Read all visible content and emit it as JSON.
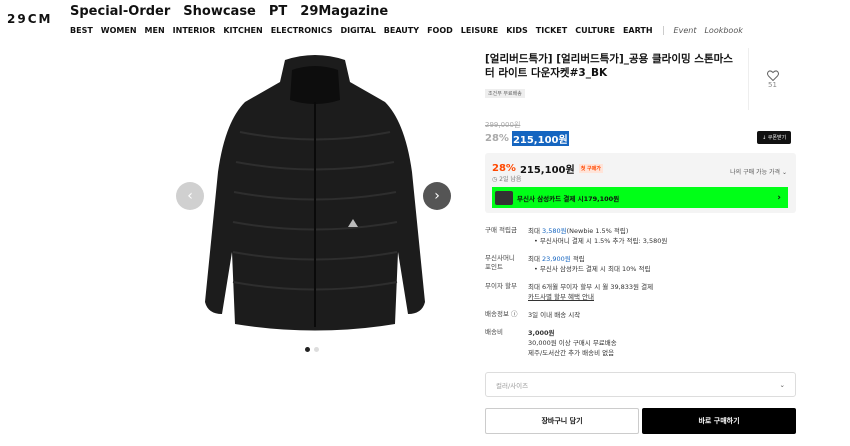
{
  "logo": "29CM",
  "topnav": [
    "Special-Order",
    "Showcase",
    "PT",
    "29Magazine"
  ],
  "catnav": [
    "BEST",
    "WOMEN",
    "MEN",
    "INTERIOR",
    "KITCHEN",
    "ELECTRONICS",
    "DIGITAL",
    "BEAUTY",
    "FOOD",
    "LEISURE",
    "KIDS",
    "TICKET",
    "CULTURE",
    "EARTH"
  ],
  "catnav_extra": [
    "Event",
    "Lookbook"
  ],
  "product": {
    "title": "[얼리버드특가] [얼리버드특가]_공용 클라이밍 스톤마스터 라이트 다운자켓#3_BK",
    "tag": "조건부 무료배송",
    "likes": "51",
    "original_price": "299,000원",
    "discount_rate": "28%",
    "price": "215,100원",
    "coupon_label": "↓ 쿠폰받기"
  },
  "benefit": {
    "rate": "28%",
    "price": "215,100원",
    "badge": "첫 구매가",
    "time_left": "◷ 2일 남음",
    "my_price": "나의 구매 가능 가격",
    "promo_text": "무신사 삼성카드 결제 시 ",
    "promo_price": "179,100원"
  },
  "details": {
    "points_label": "구매 적립금",
    "points_pre": "최대 ",
    "points_amount": "3,580원",
    "points_post": "(Newbie 1.5% 적립)",
    "points_sub": "무신사머니 결제 시 1.5% 추가 적립: 3,580원",
    "money_label1": "무신사머니",
    "money_label2": "포인트",
    "money_pre": "최대 ",
    "money_amount": "23,900원",
    "money_post": " 적립",
    "money_sub": "무신사 삼성카드 결제 시 최대 10% 적립",
    "install_label": "무이자 할부",
    "install_text": "최대 6개월 무이자 할부 시 월 39,833원 결제",
    "install_link": "카드사별 할부 혜택 안내",
    "ship_info_label": "배송정보 ⓘ",
    "ship_info": "3일 이내 배송 시작",
    "fee_label": "배송비",
    "fee": "3,000원",
    "fee_free": "30,000원 이상 구매시 무료배송",
    "fee_island": "제주/도서산간 추가 배송비 없음"
  },
  "option_placeholder": "컬러/사이즈",
  "cart_button": "장바구니 담기",
  "buy_button": "바로 구매하기",
  "colors": {
    "accent": "#ff4800",
    "promo": "#00ff17",
    "link": "#1565c0"
  }
}
